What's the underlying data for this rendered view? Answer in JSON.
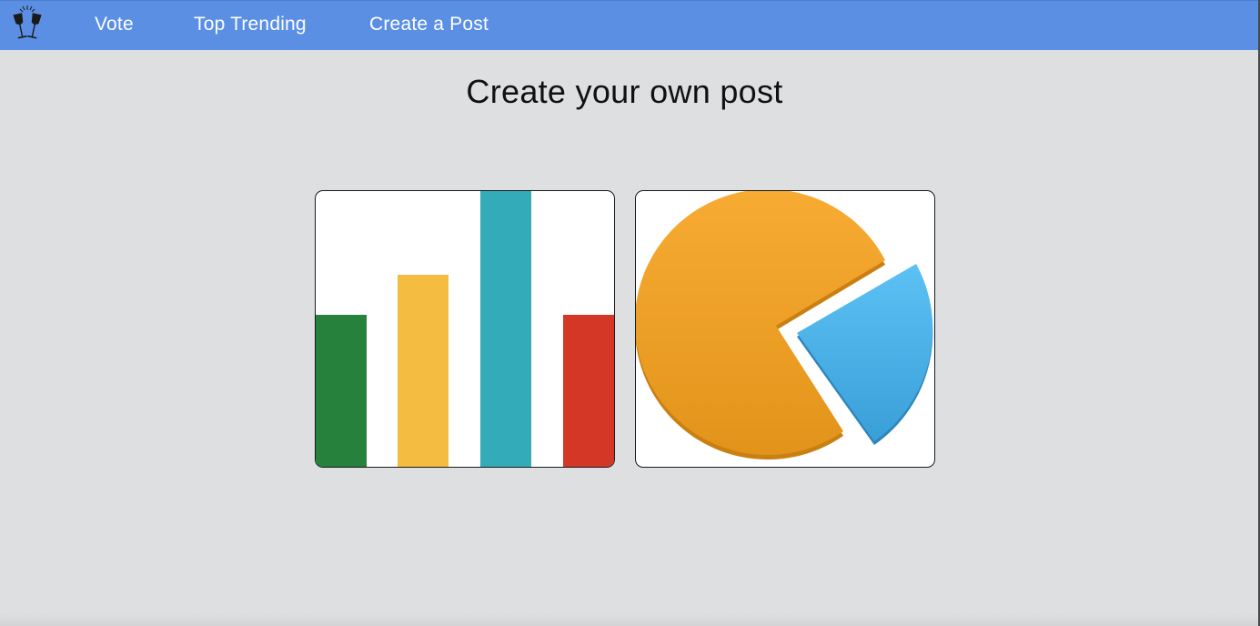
{
  "navbar": {
    "logo_icon": "champagne-toast-icon",
    "links": [
      {
        "label": "Vote"
      },
      {
        "label": "Top Trending"
      },
      {
        "label": "Create a Post"
      }
    ],
    "background": "#5b8fe4"
  },
  "main": {
    "title": "Create your own post",
    "options": [
      {
        "icon": "bar-chart-icon",
        "bar_colors": [
          "#25813b",
          "#f4bd42",
          "#33abb9",
          "#d43726"
        ]
      },
      {
        "icon": "pie-chart-icon",
        "slice_colors": [
          "#f2a12b",
          "#4db5e8"
        ]
      }
    ]
  }
}
